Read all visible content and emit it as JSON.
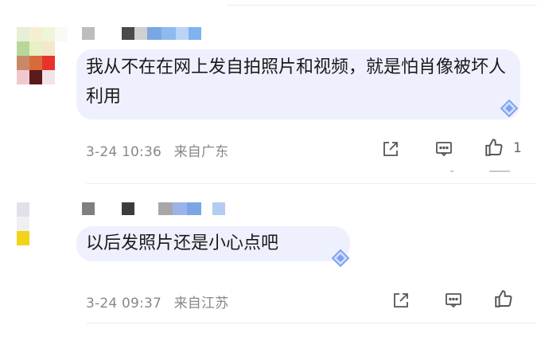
{
  "comments": [
    {
      "text": "我从不在在网上发自拍照片和视频，就是怕肖像被坏人利用",
      "time": "3-24 10:36",
      "location": "来自广东",
      "likes": "1",
      "avatar_colors": [
        "#e6efd8",
        "#f4f0cf",
        "#eef5d8",
        "#fafaf4",
        "#b7d89a",
        "#e8f0c6",
        "#f3e8c9",
        "#ffffff",
        "#c88a66",
        "#d96a3b",
        "#e8332b",
        "#ffffff",
        "#f2c8cf",
        "#5a1a1a",
        "#f0e4e6",
        "#ffffff"
      ],
      "username_colors": [
        "#bdbdbd",
        "#ffffff",
        "#4a4a4a",
        "#d0d0d0",
        "#7aa6e6",
        "#8fbaf0",
        "#b9d4f5",
        "#7fb2ee"
      ]
    },
    {
      "text": "以后发照片还是小心点吧",
      "time": "3-24 09:37",
      "location": "来自江苏",
      "likes": "",
      "avatar_colors": [
        "#e3e0ec",
        "#ffffff",
        "#ffffff",
        "#ffffff",
        "#f0f0f0",
        "#ffffff",
        "#ffffff",
        "#ffffff",
        "#f3d21a",
        "#ffffff",
        "#ffffff",
        "#ffffff",
        "#ffffff",
        "#ffffff",
        "#ffffff",
        "#ffffff"
      ],
      "username_colors": [
        "#7f7f7f",
        "#ffffff",
        "#3c3c3c",
        "#ffffff",
        "#a7a7a7",
        "#9ab4ea",
        "#7aa6e6",
        "#ffffff",
        "#b3ccf2"
      ]
    }
  ],
  "icons": {
    "share": "share-icon",
    "reply": "comment-icon",
    "like": "thumbs-up-icon",
    "badge": "diamond-badge-icon"
  },
  "colors": {
    "bubble": "#eef1fd",
    "meta_text": "#888888",
    "icon_stroke": "#555555",
    "diamond": "#7fa2f0"
  }
}
